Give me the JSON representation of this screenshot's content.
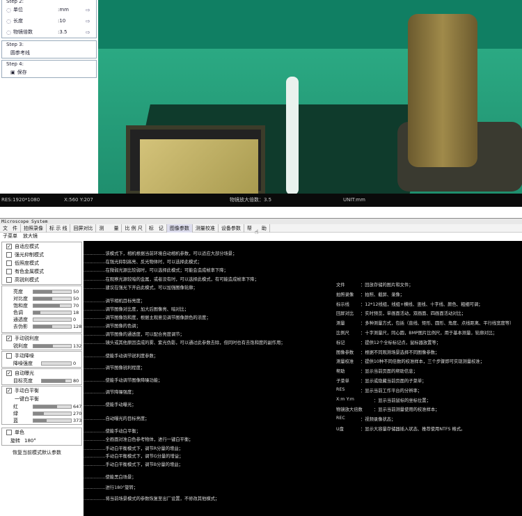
{
  "top_panel": {
    "step2_header": "Step 2:",
    "settings": [
      {
        "label": "单位",
        "value": ":mm"
      },
      {
        "label": "长度",
        "value": ":10"
      },
      {
        "label": "物镜倍数",
        "value": ":3.5"
      }
    ],
    "step3": {
      "title": "Step 3:",
      "item": "圆参考线"
    },
    "step4": {
      "title": "Step 4:",
      "item": "保存"
    }
  },
  "status_bar": {
    "resolution": "RES:1920*1080",
    "coords": "X:560 Y:207",
    "magnification": "物镜放大倍数：3.5",
    "unit": "UNIT:mm"
  },
  "app": {
    "title": "Microscope System",
    "menus": [
      "文　件",
      "拍照录像",
      "标 示 线",
      "回屏对比",
      "测　　量",
      "比 例 尺",
      "标　记",
      "图像参数",
      "测量校准",
      "设备参数",
      "帮　　助"
    ],
    "sub_menus": [
      "子菜单",
      "放大镜"
    ]
  },
  "side": {
    "modes": [
      {
        "label": "自适应模式",
        "checked": true
      },
      {
        "label": "强光抑制模式",
        "checked": false
      },
      {
        "label": "低照度模式",
        "checked": false
      },
      {
        "label": "有色金属模式",
        "checked": false
      },
      {
        "label": "高锐利模式",
        "checked": false
      }
    ],
    "image_params": [
      {
        "label": "亮度",
        "value": "50",
        "level": 0.5
      },
      {
        "label": "对比度",
        "value": "50",
        "level": 0.5
      },
      {
        "label": "饱和度",
        "value": "70",
        "level": 0.7
      },
      {
        "label": "色调",
        "value": "18",
        "level": 0.18
      },
      {
        "label": "通透度",
        "value": "0",
        "level": 0.0
      },
      {
        "label": "去伪影",
        "value": "128",
        "level": 0.5
      }
    ],
    "sharpen": {
      "label": "手动锐利度",
      "checked": true,
      "param_label": "锐利度",
      "value": "132",
      "level": 0.52
    },
    "denoise": {
      "label": "手动降噪",
      "checked": false,
      "param_label": "降噪强度",
      "value": "0",
      "level": 0.0
    },
    "auto_exposure": {
      "label": "自动曝光",
      "checked": true,
      "param_label": "目标亮度",
      "value": "80",
      "level": 0.8
    },
    "white_balance": {
      "label": "手动白平衡",
      "checked": true,
      "one_key": "一键白平衡",
      "channels": [
        {
          "label": "红",
          "value": "647",
          "level": 0.63
        },
        {
          "label": "绿",
          "value": "270",
          "level": 0.27
        },
        {
          "label": "蓝",
          "value": "373",
          "level": 0.36
        }
      ]
    },
    "mono": {
      "label": "单色",
      "checked": false
    },
    "rotate": {
      "label": "旋转",
      "value": "180°"
    },
    "restore": "恢复当前模式默认参数"
  },
  "help_left": [
    "……………该模式下，相机根据当前环境自动相机参数，可以适应大部分场景；",
    "……………在强光抑制高亮、反光物体时，可以选择此模式；",
    "……………在微弱光源比较弱时，可以选择此模式；可能会造成帧率下降；",
    "……………在观察光源较暗的金属，或者没有时，可以选择此模式，有可能造成帧率下降；",
    "……………建议在强光下开启此模式，可以加强图像轮廓；",
    "……………调节相机目标亮度；",
    "……………调节图像对比度，加大后图像亮、暗对比；",
    "……………调节图像饱和度，根据主观意见调节图像颜色的浓度；",
    "……………调节图像的色调；",
    "……………调节图像的通透度，可以配合亮度调节；",
    "……………镜头或其他原因造成的雾、紫光伪影，可以通过此参数去除，但同时也有去饱和度的副作用；",
    "……………使能手动调节锐利度参数；",
    "……………调节图像锐利程度；",
    "……………使能手动调节图像降噪功能；",
    "……………调节降噪强度；",
    "……………使能手动曝光；",
    "……………自动曝光的目标亮度；",
    "……………使能手动白平衡；",
    "……………全画面对准白色参考物体，进行一键白平衡；",
    "……………手动白平衡模式下，调节R分量的增益；",
    "……………手动白平衡模式下，调节G分量的增益；",
    "……………手动白平衡模式下，调节B分量的增益；",
    "……………使能黑白场景；",
    "……………进行180°旋转；",
    "……………将当前场景模式的参数恢复至出厂设置，不修改其他模式；"
  ],
  "help_right": [
    {
      "term": "文件",
      "desc": "：回放存储的图片和文件；"
    },
    {
      "term": "拍照录像",
      "desc": "：拍照、截屏、录像；"
    },
    {
      "term": "标示线",
      "desc": "：12*12线组，线组+横线、竖线、十字线、颜色、粗细可调；"
    },
    {
      "term": "回屏对比",
      "desc": "：实时预览，单画面活动，双画面、四画面活动对比；"
    },
    {
      "term": "测量",
      "desc": "：多种测量方式，包括（直线、矩形、圆形、角度、点线距离、平行线宽度等）"
    },
    {
      "term": "比例尺",
      "desc": "：十字测量尺，同心圆，BMP图片比例尺，用于基本测量，轮廓对比；"
    },
    {
      "term": "标记",
      "desc": "：提供12个全标标记点，鼠标器放置等；"
    },
    {
      "term": "图像参数",
      "desc": "：根据不同观测场景选择不同图像参数；"
    },
    {
      "term": "测量校准",
      "desc": "：提供10种不同倍数的校准样本，三个步骤即可实现测量校准；"
    },
    {
      "term": "帮助",
      "desc": "：显示当前页面的帮助信息；"
    },
    {
      "term": "子菜单",
      "desc": "：显示或隐藏当前页面的子菜单；"
    },
    {
      "term": "RES",
      "desc": "：显示当前工作平台的分辨率；"
    },
    {
      "term": "X:m Y:m",
      "desc": "：显示当前鼠标的坐标位置；"
    },
    {
      "term": "物镜放大倍数",
      "desc": "：显示当前测量使用的校准样本；"
    },
    {
      "term": "REC",
      "desc": "：视频录像状态；"
    },
    {
      "term": "U盘",
      "desc": "：显示大容量存储器插入状态、推荐使用NTFS 格式。"
    }
  ]
}
